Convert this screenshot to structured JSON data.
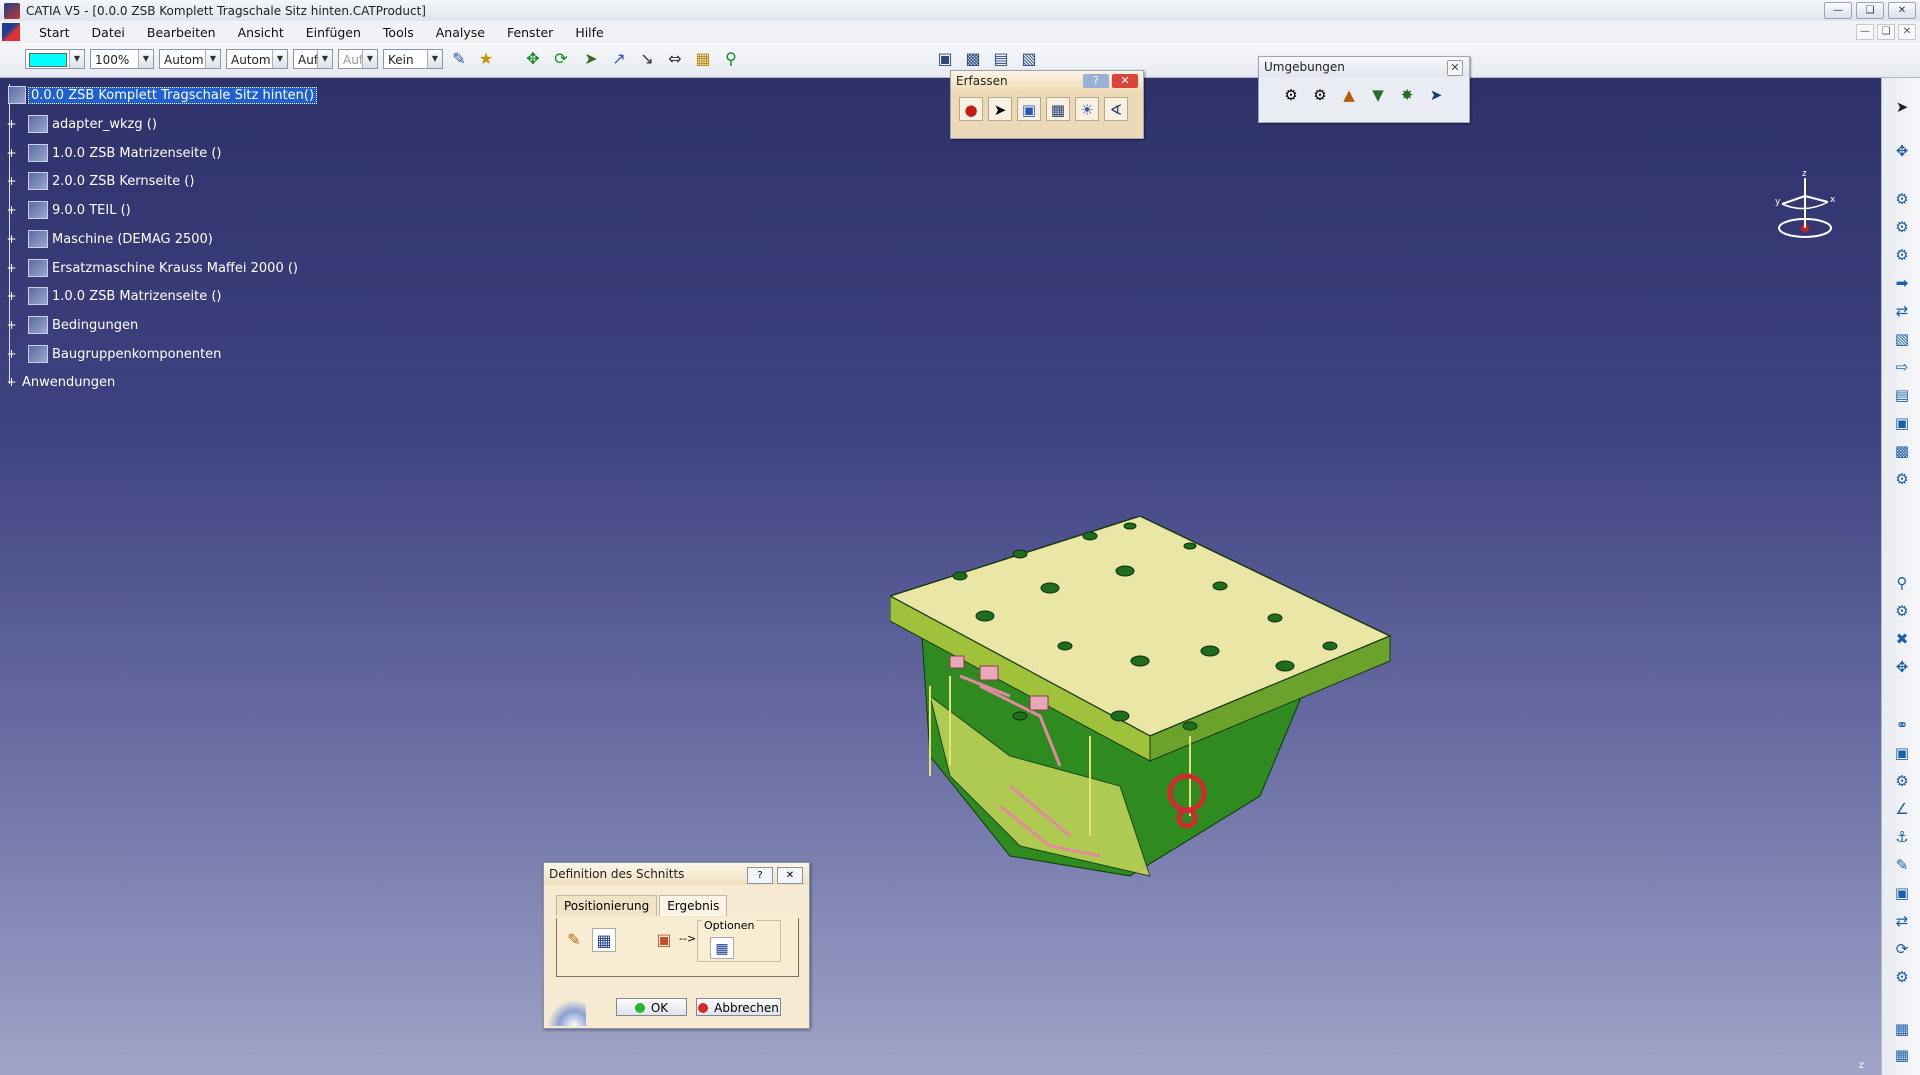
{
  "window": {
    "title": "CATIA V5 - [0.0.0 ZSB Komplett Tragschale Sitz hinten.CATProduct]",
    "controls": [
      "minimize",
      "maximize",
      "close"
    ]
  },
  "menu": {
    "items": [
      "Start",
      "Datei",
      "Bearbeiten",
      "Ansicht",
      "Einfügen",
      "Tools",
      "Analyse",
      "Fenster",
      "Hilfe"
    ]
  },
  "toolbar": {
    "color_swatch": "#00ffff",
    "zoom": "100%",
    "linetype": "Autom",
    "lineweight": "Autom",
    "layer": "Auf",
    "layer2": "Auf",
    "filter": "Kein",
    "icons": [
      "paint-brush-icon",
      "lightbulb-icon",
      "pan-icon",
      "rotate-icon",
      "fly-icon",
      "measure-icon",
      "snap-icon",
      "align-icon",
      "constraint-icon",
      "analyze-icon",
      "product-icon",
      "assembly-icon",
      "tree-icon",
      "section-icon"
    ]
  },
  "tree": {
    "root": "0.0.0 ZSB Komplett Tragschale Sitz hinten()",
    "items": [
      "adapter_wkzg ()",
      "1.0.0 ZSB Matrizenseite ()",
      "2.0.0 ZSB Kernseite ()",
      "9.0.0 TEIL ()",
      "Maschine (DEMAG 2500)",
      "Ersatzmaschine  Krauss Maffei 2000 ()",
      "1.0.0 ZSB Matrizenseite ()",
      "Bedingungen",
      "Baugruppenkomponenten",
      "Anwendungen"
    ]
  },
  "erfassen": {
    "title": "Erfassen",
    "help": "?",
    "icons": [
      "record-icon",
      "select-icon",
      "capture-icon",
      "album-icon",
      "image-icon",
      "options-icon"
    ]
  },
  "umgebungen": {
    "title": "Umgebungen",
    "icons": [
      "gear-icon",
      "settings-icon",
      "lamp-icon",
      "scene-icon",
      "light-icon",
      "cursor-icon"
    ]
  },
  "compass": {
    "labels": [
      "z",
      "y",
      "x"
    ]
  },
  "dialog": {
    "title": "Definition des Schnitts",
    "help": "?",
    "tabs": [
      "Positionierung",
      "Ergebnis"
    ],
    "active_tab": "Ergebnis",
    "arrow_text": "-->",
    "options_label": "Optionen",
    "ok_label": "OK",
    "cancel_label": "Abbrechen"
  },
  "corner_axis": "z"
}
